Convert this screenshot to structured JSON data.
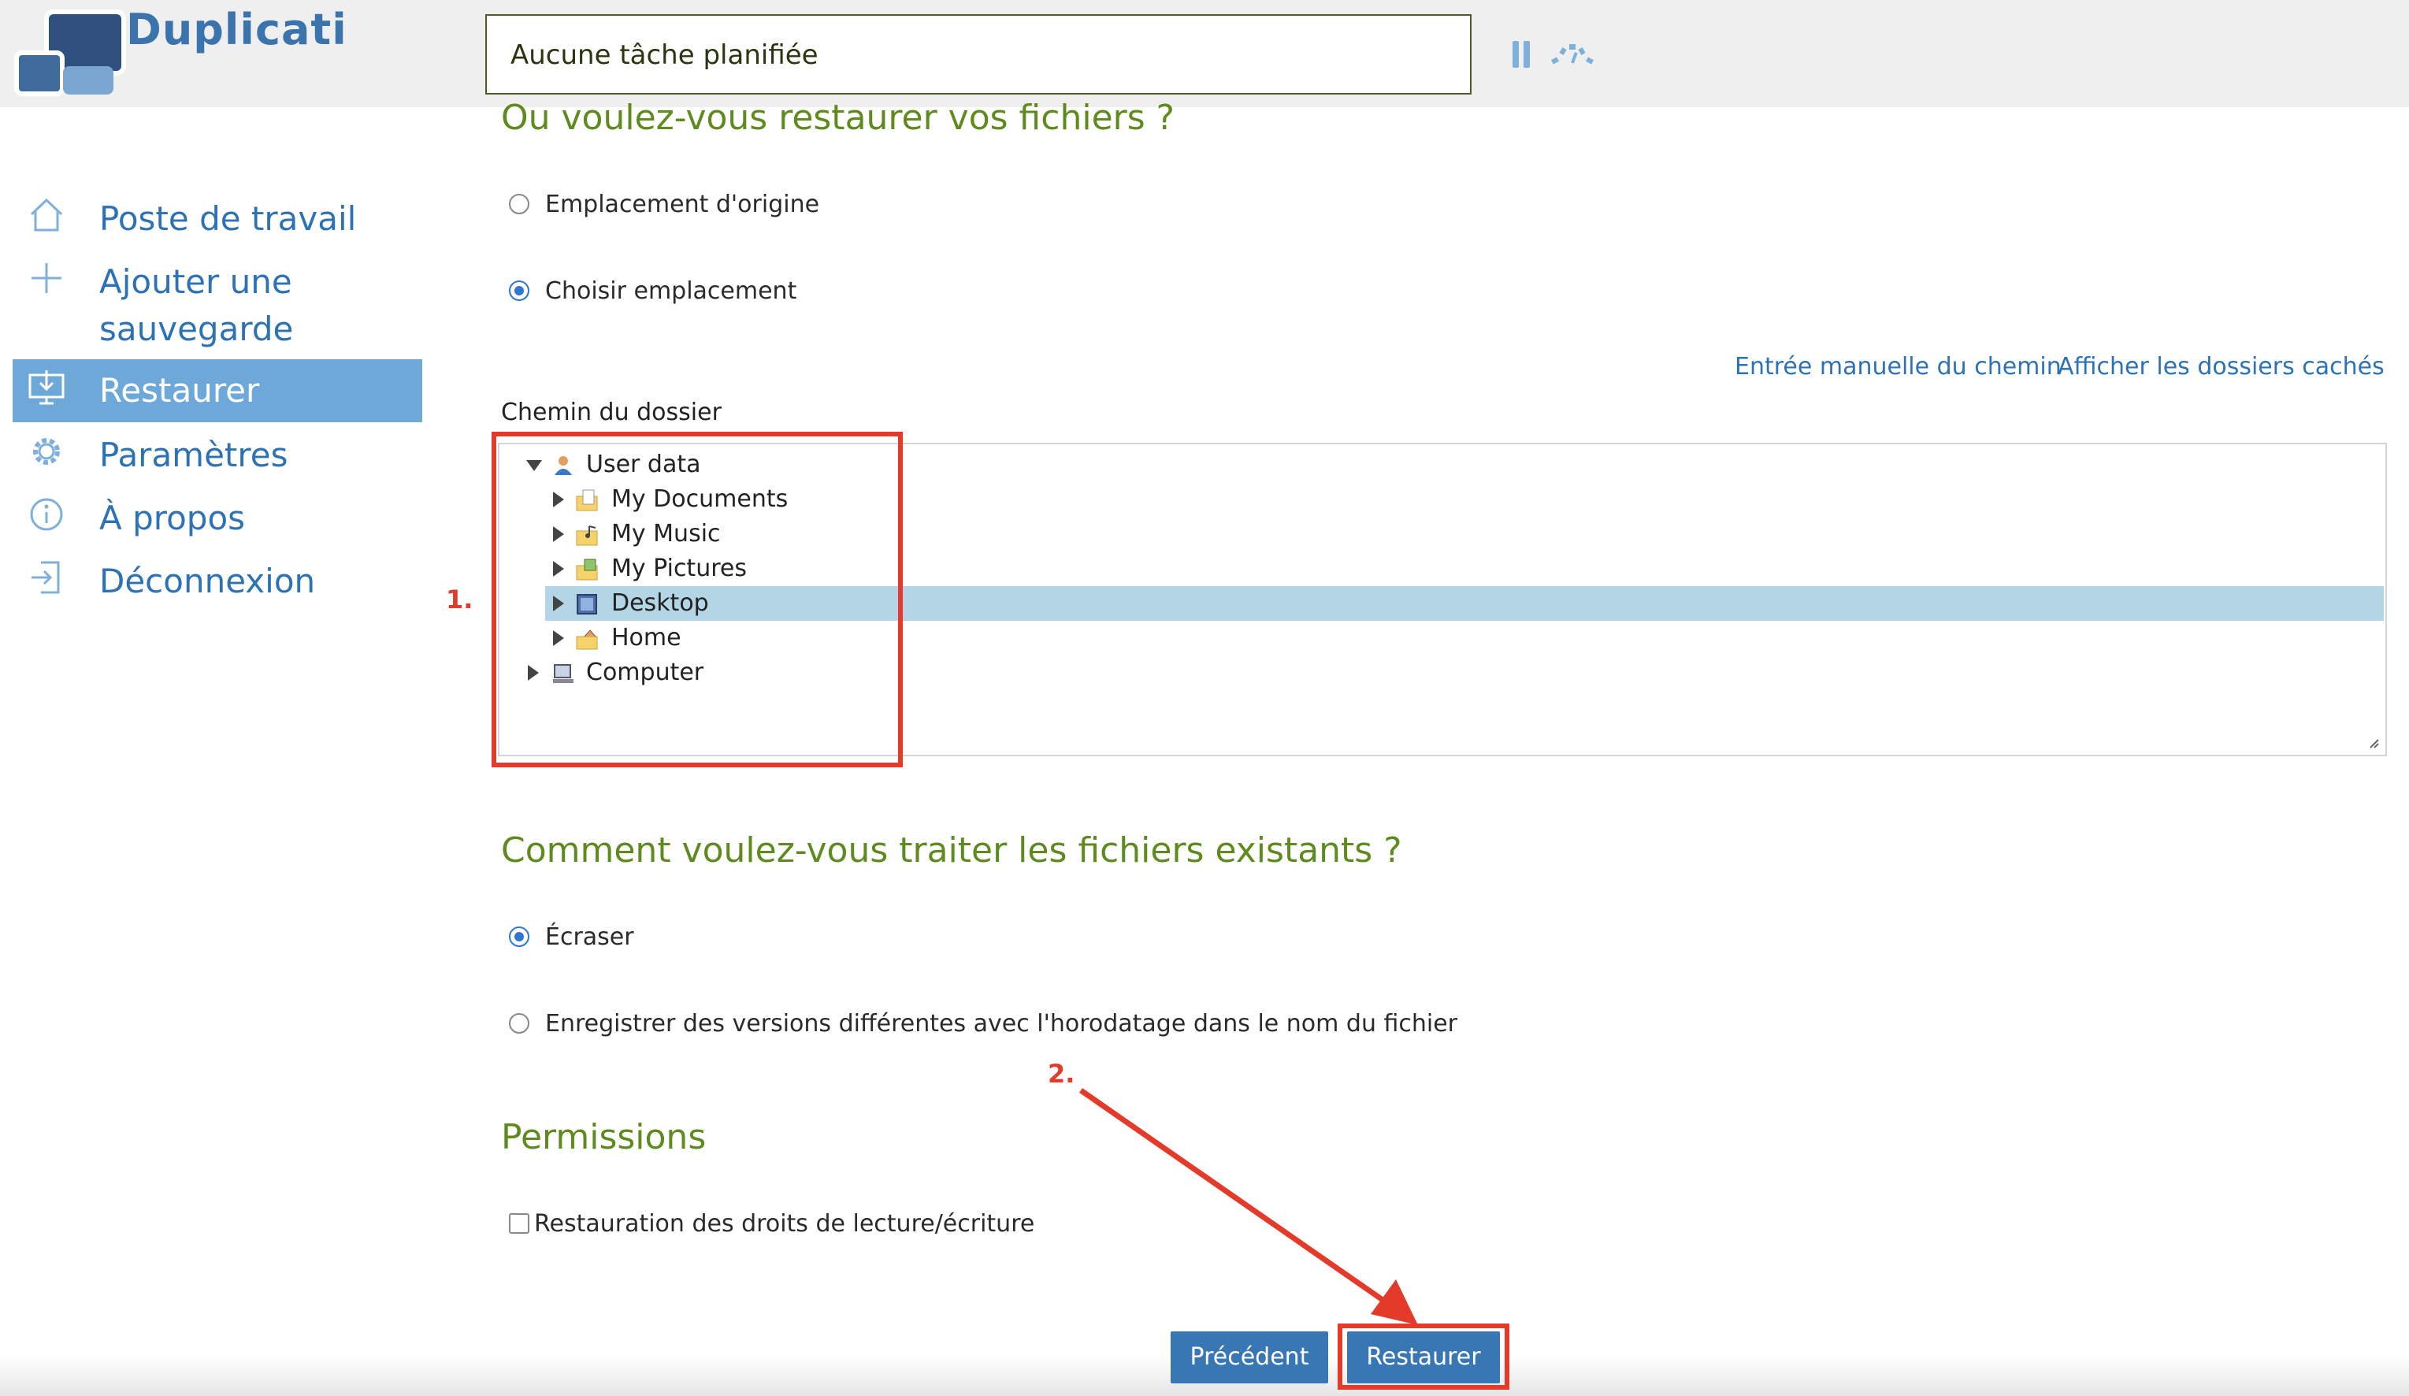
{
  "app": {
    "title": "Duplicati"
  },
  "header": {
    "status": "Aucune tâche planifiée"
  },
  "sidebar": {
    "items": [
      {
        "label": "Poste de travail",
        "icon": "home-icon"
      },
      {
        "label": "Ajouter une sauvegarde",
        "label_line1": "Ajouter une",
        "label_line2": "sauvegarde",
        "icon": "plus-icon"
      },
      {
        "label": "Restaurer",
        "icon": "restore-icon",
        "active": true
      },
      {
        "label": "Paramètres",
        "icon": "gear-icon"
      },
      {
        "label": "À propos",
        "icon": "info-icon"
      },
      {
        "label": "Déconnexion",
        "icon": "logout-icon"
      }
    ]
  },
  "restore_location": {
    "title": "Ou voulez-vous restaurer vos fichiers ?",
    "options": [
      {
        "label": "Emplacement d'origine",
        "selected": false
      },
      {
        "label": "Choisir emplacement",
        "selected": true
      }
    ],
    "links": {
      "manual_path": "Entrée manuelle du chemin",
      "show_hidden": "Afficher les dossiers cachés"
    },
    "folder_path_label": "Chemin du dossier",
    "tree": [
      {
        "label": "User data",
        "expanded": true,
        "icon": "user-folder-icon"
      },
      {
        "label": "My Documents",
        "icon": "documents-folder-icon"
      },
      {
        "label": "My Music",
        "icon": "music-folder-icon"
      },
      {
        "label": "My Pictures",
        "icon": "pictures-folder-icon"
      },
      {
        "label": "Desktop",
        "icon": "desktop-icon",
        "selected": true
      },
      {
        "label": "Home",
        "icon": "home-folder-icon"
      },
      {
        "label": "Computer",
        "icon": "computer-icon"
      }
    ]
  },
  "existing_files": {
    "title": "Comment voulez-vous traiter les fichiers existants ?",
    "options": [
      {
        "label": "Écraser",
        "selected": true
      },
      {
        "label": "Enregistrer des versions différentes avec l'horodatage dans le nom du fichier",
        "selected": false
      }
    ]
  },
  "permissions": {
    "title": "Permissions",
    "checkbox_label": "Restauration des droits de lecture/écriture",
    "checked": false
  },
  "buttons": {
    "previous": "Précédent",
    "restore": "Restaurer"
  },
  "annotations": {
    "step1": "1.",
    "step2": "2.",
    "color": "#e33a2a"
  },
  "colors": {
    "accent": "#3877b3",
    "section_title": "#5e8a1e",
    "active_nav": "#6da8d8"
  }
}
